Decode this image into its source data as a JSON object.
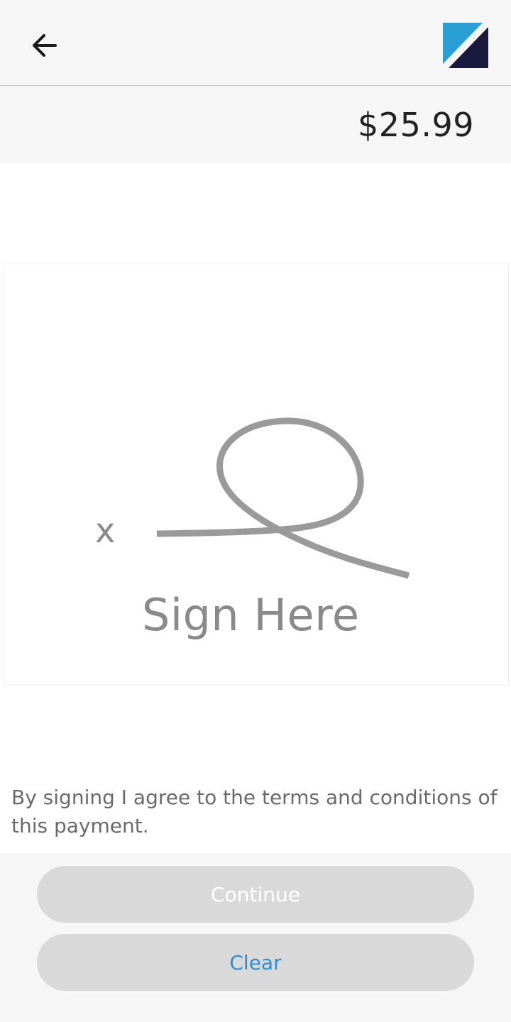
{
  "header": {
    "back_icon": "arrow-left-icon",
    "logo_icon": "brand-logo",
    "colors": {
      "logo_light": "#2a9fd6",
      "logo_dark": "#1a1a3e"
    }
  },
  "payment": {
    "amount": "$25.99"
  },
  "signature": {
    "x_mark": "x",
    "hint": "Sign Here",
    "stroke_color": "#9a9a9a"
  },
  "terms": {
    "text": "By signing I agree to the terms and conditions of this payment."
  },
  "actions": {
    "continue_label": "Continue",
    "clear_label": "Clear",
    "colors": {
      "button_bg": "#d9d9d9",
      "continue_text": "#ffffff",
      "clear_text": "#2b8fd6"
    }
  }
}
